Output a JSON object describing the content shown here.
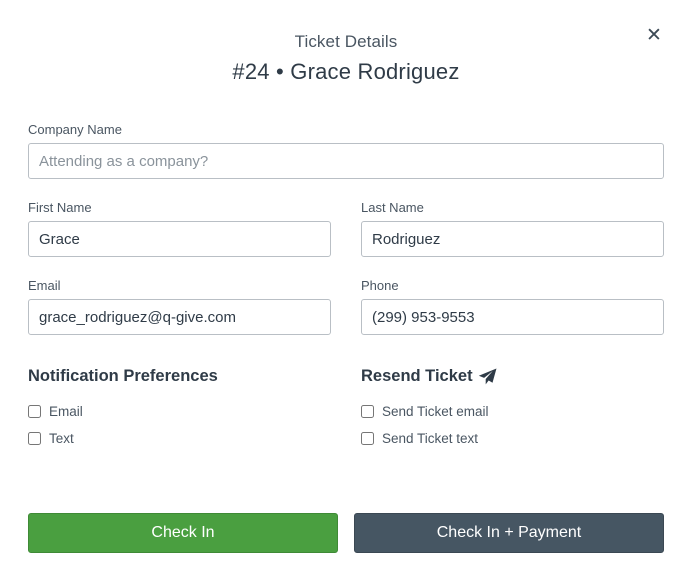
{
  "header": {
    "subtitle": "Ticket Details",
    "title": "#24 • Grace Rodriguez",
    "close_icon": "close-icon"
  },
  "fields": {
    "company": {
      "label": "Company Name",
      "value": "",
      "placeholder": "Attending as a company?"
    },
    "first_name": {
      "label": "First Name",
      "value": "Grace"
    },
    "last_name": {
      "label": "Last Name",
      "value": "Rodriguez"
    },
    "email": {
      "label": "Email",
      "value": "grace_rodriguez@q-give.com"
    },
    "phone": {
      "label": "Phone",
      "value": "(299) 953-9553"
    }
  },
  "notifications": {
    "title": "Notification Preferences",
    "options": [
      {
        "label": "Email",
        "checked": false
      },
      {
        "label": "Text",
        "checked": false
      }
    ]
  },
  "resend": {
    "title": "Resend Ticket",
    "icon": "paper-plane-icon",
    "options": [
      {
        "label": "Send Ticket email",
        "checked": false
      },
      {
        "label": "Send Ticket text",
        "checked": false
      }
    ]
  },
  "buttons": {
    "check_in": "Check In",
    "check_in_payment": "Check In + Payment"
  },
  "colors": {
    "check_in_bg": "#4a9f40",
    "payment_bg": "#465663",
    "text": "#2f3b47"
  }
}
